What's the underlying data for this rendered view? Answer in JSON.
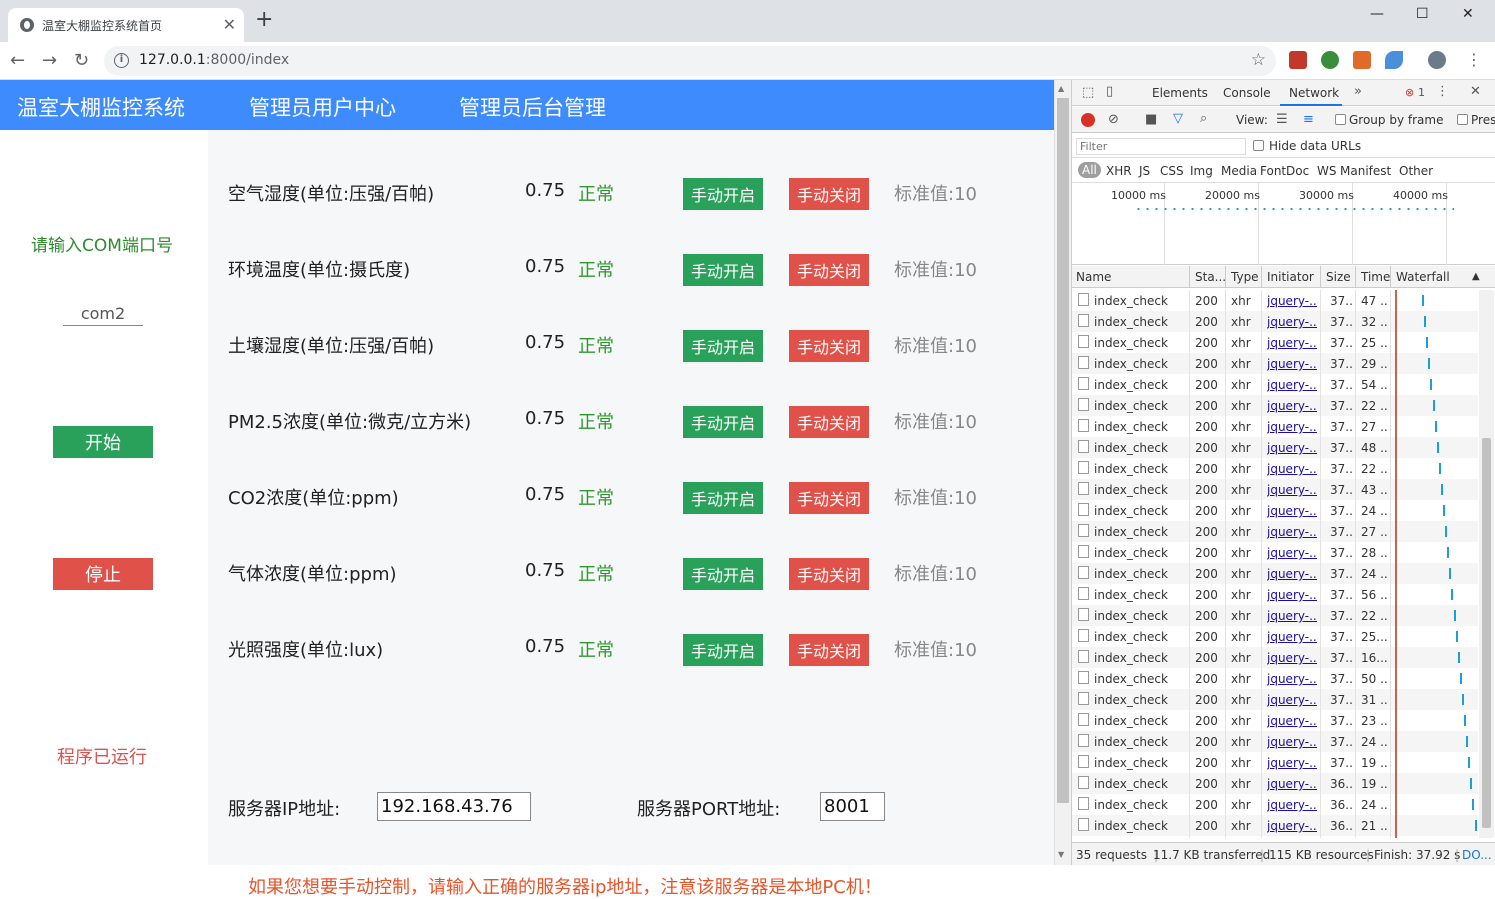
{
  "browser": {
    "tab_title": "温室大棚监控系统首页",
    "new_tab": "+",
    "url_host": "127.0.0.1",
    "url_rest": ":8000/index",
    "win_min": "—",
    "win_max": "☐",
    "win_close": "✕"
  },
  "navbar": {
    "brand": "温室大棚监控系统",
    "items": [
      "管理员用户中心",
      "管理员后台管理"
    ],
    "color": "#3d8bfd"
  },
  "sidebar": {
    "com_label": "请输入COM端口号",
    "com_value": "com2",
    "start_label": "开始",
    "stop_label": "停止",
    "status_text": "程序已运行",
    "start_color": "#2aa15b",
    "stop_color": "#e0514a"
  },
  "sensors": [
    {
      "label": "空气湿度(单位:压强/百帕)",
      "value": "0.75",
      "state": "正常",
      "on": "手动开启",
      "off": "手动关闭",
      "std": "标准值:10"
    },
    {
      "label": "环境温度(单位:摄氏度)",
      "value": "0.75",
      "state": "正常",
      "on": "手动开启",
      "off": "手动关闭",
      "std": "标准值:10"
    },
    {
      "label": "土壤湿度(单位:压强/百帕)",
      "value": "0.75",
      "state": "正常",
      "on": "手动开启",
      "off": "手动关闭",
      "std": "标准值:10"
    },
    {
      "label": "PM2.5浓度(单位:微克/立方米)",
      "value": "0.75",
      "state": "正常",
      "on": "手动开启",
      "off": "手动关闭",
      "std": "标准值:10"
    },
    {
      "label": "CO2浓度(单位:ppm)",
      "value": "0.75",
      "state": "正常",
      "on": "手动开启",
      "off": "手动关闭",
      "std": "标准值:10"
    },
    {
      "label": "气体浓度(单位:ppm)",
      "value": "0.75",
      "state": "正常",
      "on": "手动开启",
      "off": "手动关闭",
      "std": "标准值:10"
    },
    {
      "label": "光照强度(单位:lux)",
      "value": "0.75",
      "state": "正常",
      "on": "手动开启",
      "off": "手动关闭",
      "std": "标准值:10"
    }
  ],
  "server": {
    "ip_label": "服务器IP地址:",
    "ip_value": "192.168.43.76",
    "port_label": "服务器PORT地址:",
    "port_value": "8001"
  },
  "warning": "如果您想要手动控制，请输入正确的服务器ip地址，注意该服务器是本地PC机！",
  "devtools": {
    "tabs": [
      "Elements",
      "Console",
      "Network"
    ],
    "active_tab": "Network",
    "more": "»",
    "error_count": "1",
    "view_label": "View:",
    "group_by_frame": "Group by frame",
    "preserve": "Pres",
    "filter_placeholder": "Filter",
    "hide_data_urls": "Hide data URLs",
    "filter_types": [
      "All",
      "XHR",
      "JS",
      "CSS",
      "Img",
      "Media",
      "Font",
      "Doc",
      "WS",
      "Manifest",
      "Other"
    ],
    "timeline_ticks": [
      "10000 ms",
      "20000 ms",
      "30000 ms",
      "40000 ms"
    ],
    "columns": [
      "Name",
      "Sta...",
      "Type",
      "Initiator",
      "Size",
      "Time",
      "Waterfall"
    ],
    "requests": [
      {
        "name": "index_check",
        "status": "200",
        "type": "xhr",
        "initiator": "jquery-...",
        "size": "37...",
        "time": "47 ..."
      },
      {
        "name": "index_check",
        "status": "200",
        "type": "xhr",
        "initiator": "jquery-...",
        "size": "37...",
        "time": "32 ..."
      },
      {
        "name": "index_check",
        "status": "200",
        "type": "xhr",
        "initiator": "jquery-...",
        "size": "37...",
        "time": "25 ..."
      },
      {
        "name": "index_check",
        "status": "200",
        "type": "xhr",
        "initiator": "jquery-...",
        "size": "37...",
        "time": "29 ..."
      },
      {
        "name": "index_check",
        "status": "200",
        "type": "xhr",
        "initiator": "jquery-...",
        "size": "37...",
        "time": "54 ..."
      },
      {
        "name": "index_check",
        "status": "200",
        "type": "xhr",
        "initiator": "jquery-...",
        "size": "37...",
        "time": "22 ..."
      },
      {
        "name": "index_check",
        "status": "200",
        "type": "xhr",
        "initiator": "jquery-...",
        "size": "37...",
        "time": "27 ..."
      },
      {
        "name": "index_check",
        "status": "200",
        "type": "xhr",
        "initiator": "jquery-...",
        "size": "37...",
        "time": "48 ..."
      },
      {
        "name": "index_check",
        "status": "200",
        "type": "xhr",
        "initiator": "jquery-...",
        "size": "37...",
        "time": "22 ..."
      },
      {
        "name": "index_check",
        "status": "200",
        "type": "xhr",
        "initiator": "jquery-...",
        "size": "37...",
        "time": "43 ..."
      },
      {
        "name": "index_check",
        "status": "200",
        "type": "xhr",
        "initiator": "jquery-...",
        "size": "37...",
        "time": "24 ..."
      },
      {
        "name": "index_check",
        "status": "200",
        "type": "xhr",
        "initiator": "jquery-...",
        "size": "37...",
        "time": "27 ..."
      },
      {
        "name": "index_check",
        "status": "200",
        "type": "xhr",
        "initiator": "jquery-...",
        "size": "37...",
        "time": "28 ..."
      },
      {
        "name": "index_check",
        "status": "200",
        "type": "xhr",
        "initiator": "jquery-...",
        "size": "37...",
        "time": "24 ..."
      },
      {
        "name": "index_check",
        "status": "200",
        "type": "xhr",
        "initiator": "jquery-...",
        "size": "37...",
        "time": "56 ..."
      },
      {
        "name": "index_check",
        "status": "200",
        "type": "xhr",
        "initiator": "jquery-...",
        "size": "37...",
        "time": "22 ..."
      },
      {
        "name": "index_check",
        "status": "200",
        "type": "xhr",
        "initiator": "jquery-...",
        "size": "37...",
        "time": "25..."
      },
      {
        "name": "index_check",
        "status": "200",
        "type": "xhr",
        "initiator": "jquery-...",
        "size": "37...",
        "time": "16..."
      },
      {
        "name": "index_check",
        "status": "200",
        "type": "xhr",
        "initiator": "jquery-...",
        "size": "37...",
        "time": "50 ..."
      },
      {
        "name": "index_check",
        "status": "200",
        "type": "xhr",
        "initiator": "jquery-...",
        "size": "37...",
        "time": "31 ..."
      },
      {
        "name": "index_check",
        "status": "200",
        "type": "xhr",
        "initiator": "jquery-...",
        "size": "37...",
        "time": "23 ..."
      },
      {
        "name": "index_check",
        "status": "200",
        "type": "xhr",
        "initiator": "jquery-...",
        "size": "37...",
        "time": "24 ..."
      },
      {
        "name": "index_check",
        "status": "200",
        "type": "xhr",
        "initiator": "jquery-...",
        "size": "37...",
        "time": "19 ..."
      },
      {
        "name": "index_check",
        "status": "200",
        "type": "xhr",
        "initiator": "jquery-...",
        "size": "36...",
        "time": "19 ..."
      },
      {
        "name": "index_check",
        "status": "200",
        "type": "xhr",
        "initiator": "jquery-...",
        "size": "36...",
        "time": "24 ..."
      },
      {
        "name": "index_check",
        "status": "200",
        "type": "xhr",
        "initiator": "jquery-...",
        "size": "36...",
        "time": "21 ..."
      }
    ],
    "status_bar": {
      "requests": "35 requests",
      "transferred": "11.7 KB transferred",
      "resources": "115 KB resources",
      "finish": "Finish: 37.92 s",
      "dom": "DO..."
    }
  }
}
